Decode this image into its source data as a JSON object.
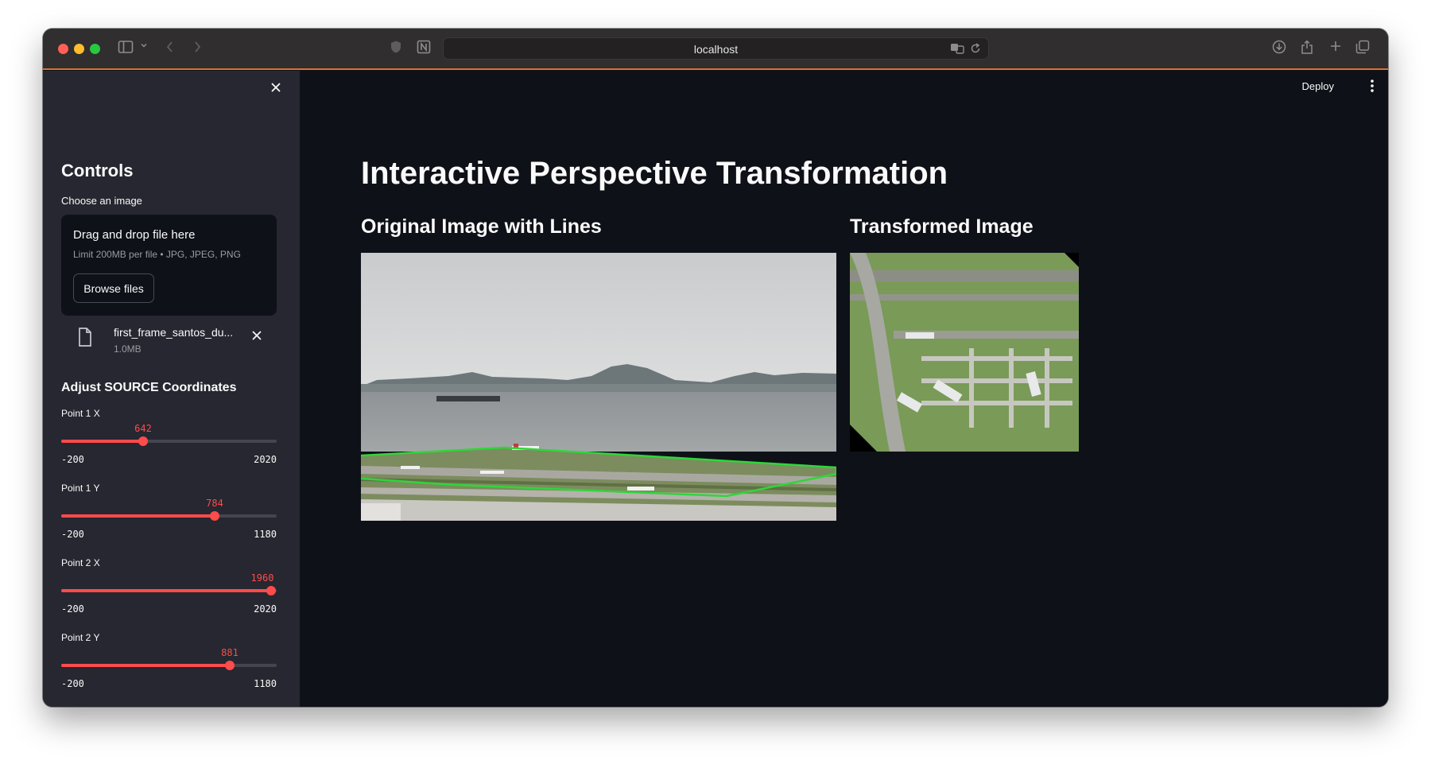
{
  "browser": {
    "url": "localhost",
    "icons": [
      "sidebar-toggle-icon",
      "chevron-down-icon",
      "back-icon",
      "forward-icon",
      "shield-icon",
      "notion-icon",
      "translate-icon",
      "reload-icon",
      "download-icon",
      "share-icon",
      "new-tab-icon",
      "tab-overview-icon"
    ]
  },
  "app": {
    "deploy_label": "Deploy",
    "title": "Interactive Perspective Transformation",
    "accent_color": "#ff4b4b"
  },
  "sidebar": {
    "heading": "Controls",
    "uploader": {
      "label": "Choose an image",
      "drop_text": "Drag and drop file here",
      "limit_text": "Limit 200MB per file • JPG, JPEG, PNG",
      "browse_label": "Browse files"
    },
    "file": {
      "name": "first_frame_santos_du...",
      "size": "1.0MB"
    },
    "section_heading": "Adjust SOURCE Coordinates",
    "sliders": [
      {
        "label": "Point 1 X",
        "value": "642",
        "min": "-200",
        "max": "2020"
      },
      {
        "label": "Point 1 Y",
        "value": "784",
        "min": "-200",
        "max": "1180"
      },
      {
        "label": "Point 2 X",
        "value": "1960",
        "min": "-200",
        "max": "2020"
      },
      {
        "label": "Point 2 Y",
        "value": "881",
        "min": "-200",
        "max": "1180"
      }
    ]
  },
  "main": {
    "original_heading": "Original Image with Lines",
    "transformed_heading": "Transformed Image"
  }
}
